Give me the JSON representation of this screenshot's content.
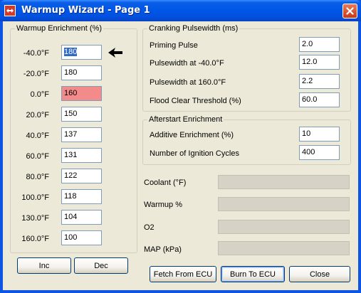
{
  "window": {
    "title": "Warmup Wizard - Page 1"
  },
  "warmup": {
    "legend": "Warmup Enrichment (%)",
    "rows": [
      {
        "temp": "-40.0°F",
        "value": "180"
      },
      {
        "temp": "-20.0°F",
        "value": "180"
      },
      {
        "temp": "0.0°F",
        "value": "160"
      },
      {
        "temp": "20.0°F",
        "value": "150"
      },
      {
        "temp": "40.0°F",
        "value": "137"
      },
      {
        "temp": "60.0°F",
        "value": "131"
      },
      {
        "temp": "80.0°F",
        "value": "122"
      },
      {
        "temp": "100.0°F",
        "value": "118"
      },
      {
        "temp": "130.0°F",
        "value": "104"
      },
      {
        "temp": "160.0°F",
        "value": "100"
      }
    ],
    "inc_label": "Inc",
    "dec_label": "Dec"
  },
  "cranking": {
    "legend": "Cranking Pulsewidth (ms)",
    "rows": [
      {
        "label": "Priming Pulse",
        "value": "2.0"
      },
      {
        "label": "Pulsewidth at -40.0°F",
        "value": "12.0"
      },
      {
        "label": "Pulsewidth at 160.0°F",
        "value": "2.2"
      },
      {
        "label": "Flood Clear Threshold (%)",
        "value": "60.0"
      }
    ]
  },
  "afterstart": {
    "legend": "Afterstart Enrichment",
    "rows": [
      {
        "label": "Additive Enrichment (%)",
        "value": "10"
      },
      {
        "label": "Number of Ignition Cycles",
        "value": "400"
      }
    ]
  },
  "gauges": {
    "coolant": {
      "label": "Coolant (°F)"
    },
    "warmup": {
      "label": "Warmup %"
    },
    "o2": {
      "label": "O2"
    },
    "map": {
      "label": "MAP (kPa)"
    }
  },
  "actions": {
    "fetch_label": "Fetch From ECU",
    "burn_label": "Burn To ECU",
    "close_label": "Close"
  },
  "colors": {
    "titlebar": "#0057e6",
    "hot_field": "#f48b8b",
    "selection": "#316ac5"
  },
  "icons": {
    "app": "app-logo-icon",
    "close": "close-icon",
    "pointer": "arrow-left-icon"
  }
}
